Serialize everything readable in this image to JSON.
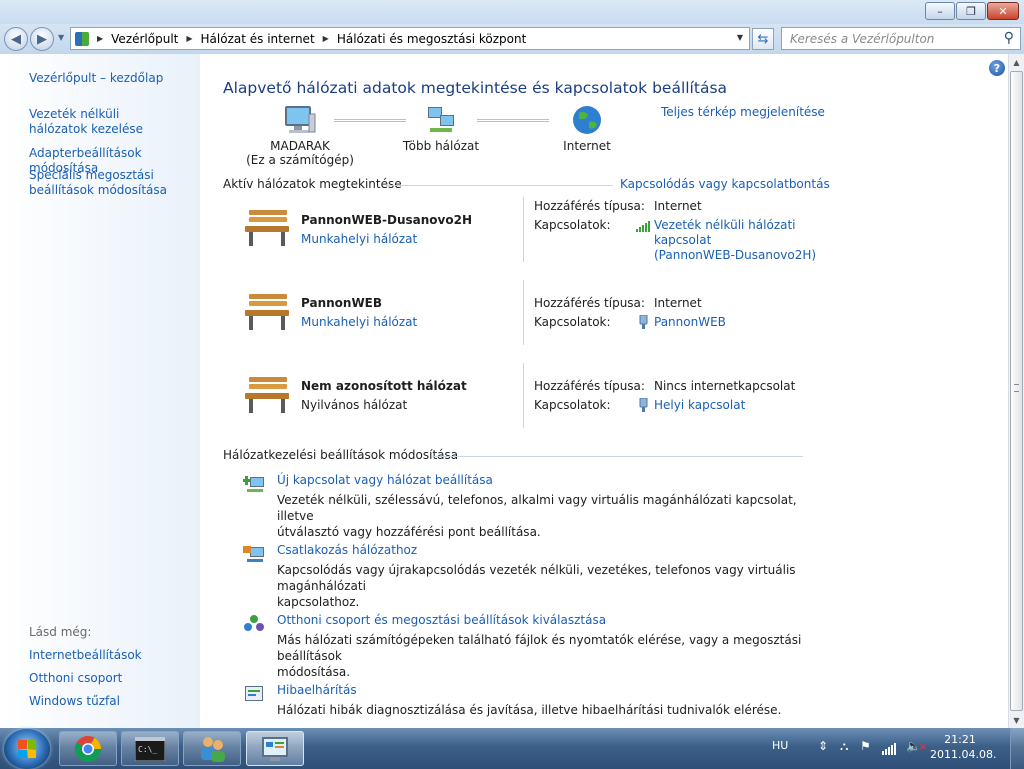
{
  "window": {
    "min": "–",
    "max": "❐",
    "close": "✕"
  },
  "address": {
    "crumbs": [
      "Vezérlőpult",
      "Hálózat és internet",
      "Hálózati és megosztási központ"
    ],
    "search_placeholder": "Keresés a Vezérlőpulton"
  },
  "sidebar": {
    "links": [
      "Vezérlőpult – kezdőlap",
      "Vezeték nélküli hálózatok kezelése",
      "Adapterbeállítások módosítása",
      "Speciális megosztási beállítások módosítása"
    ],
    "see_also_label": "Lásd még:",
    "see_also": [
      "Internetbeállítások",
      "Otthoni csoport",
      "Windows tűzfal"
    ]
  },
  "main": {
    "title": "Alapvető hálózati adatok megtekintése és kapcsolatok beállítása",
    "full_map_link": "Teljes térkép megjelenítése",
    "map": {
      "computer_name": "MADARAK",
      "computer_sub": "(Ez a számítógép)",
      "multi_network": "Több hálózat",
      "internet": "Internet"
    },
    "active_section": "Aktív hálózatok megtekintése",
    "connect_link": "Kapcsolódás vagy kapcsolatbontás",
    "access_type_label": "Hozzáférés típusa:",
    "connections_label": "Kapcsolatok:",
    "networks": [
      {
        "name": "PannonWEB-Dusanovo2H",
        "type": "Munkahelyi hálózat",
        "access": "Internet",
        "connection": [
          "Vezeték nélküli hálózati",
          "kapcsolat",
          "(PannonWEB-Dusanovo2H)"
        ]
      },
      {
        "name": "PannonWEB",
        "type": "Munkahelyi hálózat",
        "access": "Internet",
        "connection": [
          "PannonWEB"
        ]
      },
      {
        "name": "Nem azonosított hálózat",
        "type": "Nyilvános hálózat",
        "access": "Nincs internetkapcsolat",
        "connection": [
          "Helyi kapcsolat"
        ]
      }
    ],
    "settings_section": "Hálózatkezelési beállítások módosítása",
    "tasks": [
      {
        "title": "Új kapcsolat vagy hálózat beállítása",
        "desc": [
          "Vezeték nélküli, szélessávú, telefonos, alkalmi vagy virtuális magánhálózati kapcsolat, illetve",
          "útválasztó vagy hozzáférési pont beállítása."
        ]
      },
      {
        "title": "Csatlakozás hálózathoz",
        "desc": [
          "Kapcsolódás vagy újrakapcsolódás vezeték nélküli, vezetékes, telefonos vagy virtuális magánhálózati",
          "kapcsolathoz."
        ]
      },
      {
        "title": "Otthoni csoport és megosztási beállítások kiválasztása",
        "desc": [
          "Más hálózati számítógépeken található fájlok és nyomtatók elérése, vagy a megosztási beállítások",
          "módosítása."
        ]
      },
      {
        "title": "Hibaelhárítás",
        "desc": [
          "Hálózati hibák diagnosztizálása és javítása, illetve hibaelhárítási tudnivalók elérése."
        ]
      }
    ]
  },
  "taskbar": {
    "lang": "HU",
    "time": "21:21",
    "date": "2011.04.08."
  }
}
